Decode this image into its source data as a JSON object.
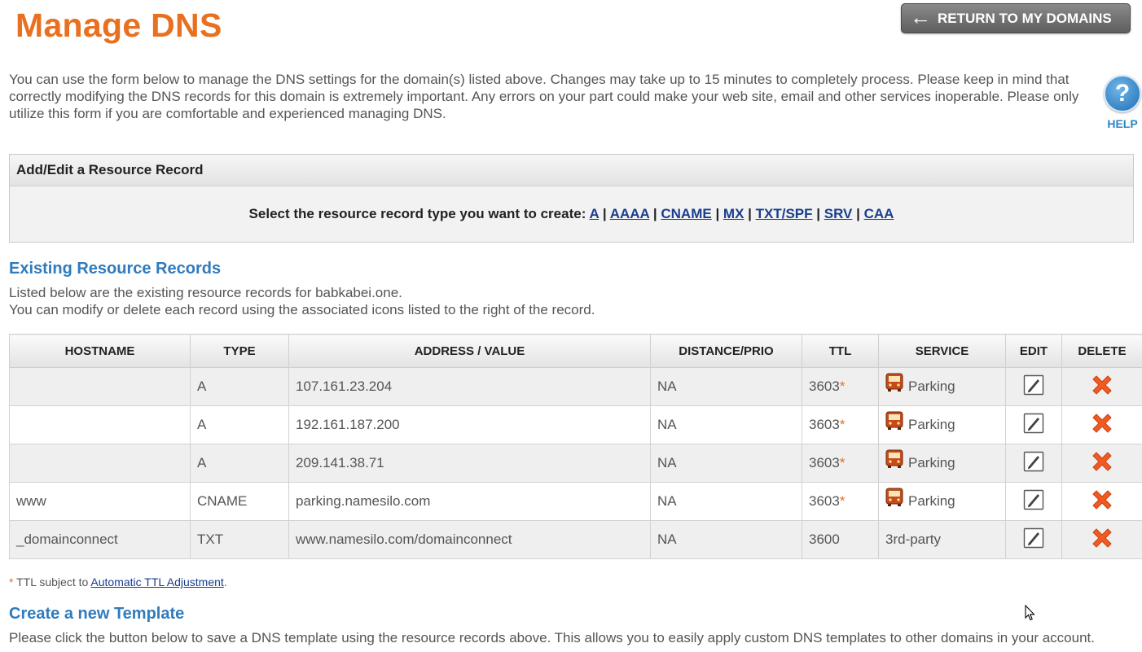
{
  "header": {
    "title": "Manage DNS",
    "return_button": "RETURN TO MY DOMAINS"
  },
  "intro_text": "You can use the form below to manage the DNS settings for the domain(s) listed above. Changes may take up to 15 minutes to completely process. Please keep in mind that correctly modifying the DNS records for this domain is extremely important. Any errors on your part could make your web site, email and other services inoperable. Please only utilize this form if you are comfortable and experienced managing DNS.",
  "help": {
    "label": "HELP",
    "glyph": "?"
  },
  "add_edit": {
    "title": "Add/Edit a Resource Record",
    "prompt": "Select the resource record type you want to create:",
    "types": [
      "A",
      "AAAA",
      "CNAME",
      "MX",
      "TXT/SPF",
      "SRV",
      "CAA"
    ]
  },
  "existing": {
    "title": "Existing Resource Records",
    "line1": "Listed below are the existing resource records for babkabei.one.",
    "line2": "You can modify or delete each record using the associated icons listed to the right of the record.",
    "columns": [
      "HOSTNAME",
      "TYPE",
      "ADDRESS / VALUE",
      "DISTANCE/PRIO",
      "TTL",
      "SERVICE",
      "EDIT",
      "DELETE"
    ],
    "rows": [
      {
        "hostname": "",
        "type": "A",
        "value": "107.161.23.204",
        "prio": "NA",
        "ttl": "3603",
        "ttl_star": "*",
        "service": "Parking",
        "service_icon": "bus-icon"
      },
      {
        "hostname": "",
        "type": "A",
        "value": "192.161.187.200",
        "prio": "NA",
        "ttl": "3603",
        "ttl_star": "*",
        "service": "Parking",
        "service_icon": "bus-icon"
      },
      {
        "hostname": "",
        "type": "A",
        "value": "209.141.38.71",
        "prio": "NA",
        "ttl": "3603",
        "ttl_star": "*",
        "service": "Parking",
        "service_icon": "bus-icon"
      },
      {
        "hostname": "www",
        "type": "CNAME",
        "value": "parking.namesilo.com",
        "prio": "NA",
        "ttl": "3603",
        "ttl_star": "*",
        "service": "Parking",
        "service_icon": "bus-icon"
      },
      {
        "hostname": "_domainconnect",
        "type": "TXT",
        "value": "www.namesilo.com/domainconnect",
        "prio": "NA",
        "ttl": "3600",
        "ttl_star": "",
        "service": "3rd-party",
        "service_icon": ""
      }
    ]
  },
  "ttl_note": {
    "star": "*",
    "text": " TTL subject to ",
    "link": "Automatic TTL Adjustment",
    "end": "."
  },
  "template": {
    "title": "Create a new Template",
    "text": "Please click the button below to save a DNS template using the resource records above. This allows you to easily apply custom DNS templates to other domains in your account."
  },
  "colors": {
    "brand_orange": "#e8701f",
    "section_blue": "#2f7bbd",
    "link_navy": "#1a3d8f",
    "delete_red": "#f15a22"
  }
}
